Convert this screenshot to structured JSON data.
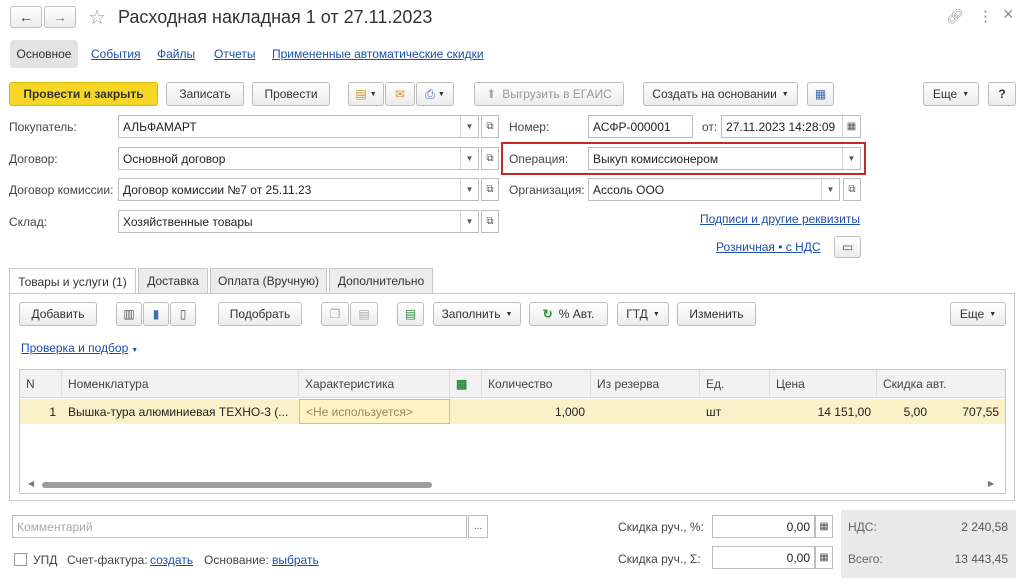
{
  "window": {
    "title": "Расходная накладная 1 от 27.11.2023",
    "nav_back": "←",
    "nav_forward": "→",
    "star": "☆",
    "link_icon": "link-icon",
    "more_icon": "⋮",
    "close": "×"
  },
  "sections": [
    "Основное",
    "События",
    "Файлы",
    "Отчеты",
    "Примененные автоматические скидки"
  ],
  "toolbar": {
    "post_close": "Провести и закрыть",
    "save": "Записать",
    "post": "Провести",
    "export_egais": "Выгрузить в ЕГАИС",
    "create_based": "Создать на основании",
    "more": "Еще",
    "help": "?"
  },
  "form": {
    "buyer_label": "Покупатель:",
    "buyer_value": "АЛЬФАМАРТ",
    "contract_label": "Договор:",
    "contract_value": "Основной договор",
    "commission_label": "Договор комиссии:",
    "commission_value": "Договор комиссии №7 от 25.11.23",
    "warehouse_label": "Склад:",
    "warehouse_value": "Хозяйственные товары",
    "number_label": "Номер:",
    "number_value": "АСФР-000001",
    "date_label": "от:",
    "date_value": "27.11.2023 14:28:09",
    "operation_label": "Операция:",
    "operation_value": "Выкуп комиссионером",
    "org_label": "Организация:",
    "org_value": "Ассоль ООО",
    "signatures_link": "Подписи и другие реквизиты",
    "price_type_link": "Розничная • с НДС"
  },
  "tabs": [
    "Товары и услуги (1)",
    "Доставка",
    "Оплата (Вручную)",
    "Дополнительно"
  ],
  "table_toolbar": {
    "add": "Добавить",
    "pick": "Подобрать",
    "fill": "Заполнить",
    "auto_pct": "% Авт.",
    "gtd": "ГТД",
    "change": "Изменить",
    "more": "Еще"
  },
  "check_link": "Проверка и подбор",
  "table": {
    "headers": [
      "N",
      "Номенклатура",
      "Характеристика",
      "",
      "Количество",
      "Из резерва",
      "Ед.",
      "Цена",
      "Скидка авт."
    ],
    "rows": [
      {
        "n": "1",
        "item": "Вышка-тура алюминиевая ТЕХНО-3 (...",
        "char": "<Не используется>",
        "qty": "1,000",
        "reserve": "",
        "unit": "шт",
        "price": "14 151,00",
        "disc_pct": "5,00",
        "disc_sum": "707,55"
      }
    ]
  },
  "footer": {
    "comment_placeholder": "Комментарий",
    "comment_btn": "...",
    "upd_label": "УПД",
    "invoice_label": "Счет-фактура:",
    "invoice_link": "создать",
    "basis_label": "Основание:",
    "basis_link": "выбрать",
    "manual_disc_pct_label": "Скидка руч., %:",
    "manual_disc_pct_value": "0,00",
    "manual_disc_sum_label": "Скидка руч., Σ:",
    "manual_disc_sum_value": "0,00",
    "vat_label": "НДС:",
    "vat_value": "2 240,58",
    "total_label": "Всего:",
    "total_value": "13 443,45"
  },
  "colors": {
    "primary": "#f6d728",
    "link": "#1b4fa8",
    "highlight_border": "#c62828",
    "selected_row": "#fbf1c9",
    "totals_bg": "#e9e9e9"
  }
}
